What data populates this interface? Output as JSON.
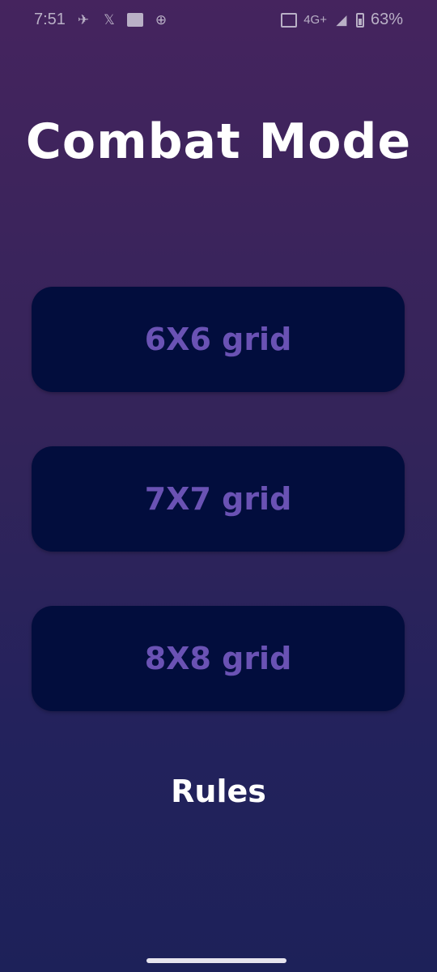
{
  "status_bar": {
    "time": "7:51",
    "network": "4G+",
    "battery": "63%",
    "icons": [
      "app-notification-icon",
      "x-icon",
      "app-box-icon",
      "data-saver-icon",
      "volte-icon",
      "signal-icon",
      "battery-icon"
    ]
  },
  "title": "Combat Mode",
  "buttons": [
    {
      "label": "6X6 grid"
    },
    {
      "label": "7X7 grid"
    },
    {
      "label": "8X8 grid"
    }
  ],
  "rules_label": "Rules",
  "colors": {
    "background_top": "#45245e",
    "background_bottom": "#1d2159",
    "button_bg": "#020d3d",
    "button_text": "#6a52b4",
    "title_text": "#ffffff"
  }
}
